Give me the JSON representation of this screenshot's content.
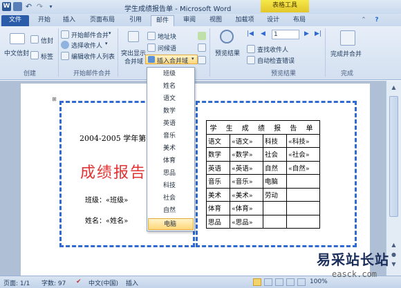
{
  "window": {
    "title": "学生成绩报告单 - Microsoft Word",
    "context_group": "表格工具"
  },
  "tabs": [
    "文件",
    "开始",
    "插入",
    "页面布局",
    "引用",
    "邮件",
    "审阅",
    "视图",
    "加载项",
    "设计",
    "布局"
  ],
  "ribbon": {
    "create": {
      "label": "创建",
      "chinese_envelope": "中文信封",
      "envelope": "信封",
      "labels": "标签"
    },
    "start_merge": {
      "label": "开始邮件合并",
      "start_mail_merge": "开始邮件合并",
      "select_recipients": "选择收件人",
      "edit_recipient_list": "编辑收件人列表"
    },
    "write_insert": {
      "highlight_merge_fields_line1": "突出显示",
      "highlight_merge_fields_line2": "合并域",
      "address_block": "地址块",
      "greeting_line": "问候语",
      "insert_merge_field": "插入合并域"
    },
    "preview": {
      "label": "预览结果",
      "preview_results": "预览结果",
      "record_number": "1",
      "find_recipient": "查找收件人",
      "auto_check_errors": "自动检查错误"
    },
    "finish": {
      "label": "完成",
      "finish_merge": "完成并合并"
    }
  },
  "merge_field_menu": {
    "items": [
      "班级",
      "姓名",
      "语文",
      "数学",
      "英语",
      "音乐",
      "美术",
      "体育",
      "思品",
      "科技",
      "社会",
      "自然",
      "电脑"
    ],
    "selected": "电脑"
  },
  "document": {
    "school_year": "2004-2005 学年第一",
    "report_title": "成绩报告",
    "class_line": "班级：«班级»",
    "name_line": "姓名：«姓名»",
    "score_table": {
      "title": "学 生 成 绩 报 告 单",
      "rows": [
        [
          "语文",
          "«语文»",
          "科技",
          "«科技»"
        ],
        [
          "数学",
          "«数学»",
          "社会",
          "«社会»"
        ],
        [
          "英语",
          "«英语»",
          "自然",
          "«自然»"
        ],
        [
          "音乐",
          "«音乐»",
          "电脑",
          ""
        ],
        [
          "美术",
          "«美术»",
          "劳动",
          ""
        ],
        [
          "体育",
          "«体育»",
          "",
          ""
        ],
        [
          "思品",
          "«思品»",
          "",
          ""
        ]
      ]
    }
  },
  "status_bar": {
    "page": "页面: 1/1",
    "words": "字数: 97",
    "language": "中文(中国)",
    "mode": "插入",
    "zoom": "100%"
  },
  "watermark": {
    "name": "易采站长站",
    "url": "easck.com"
  }
}
